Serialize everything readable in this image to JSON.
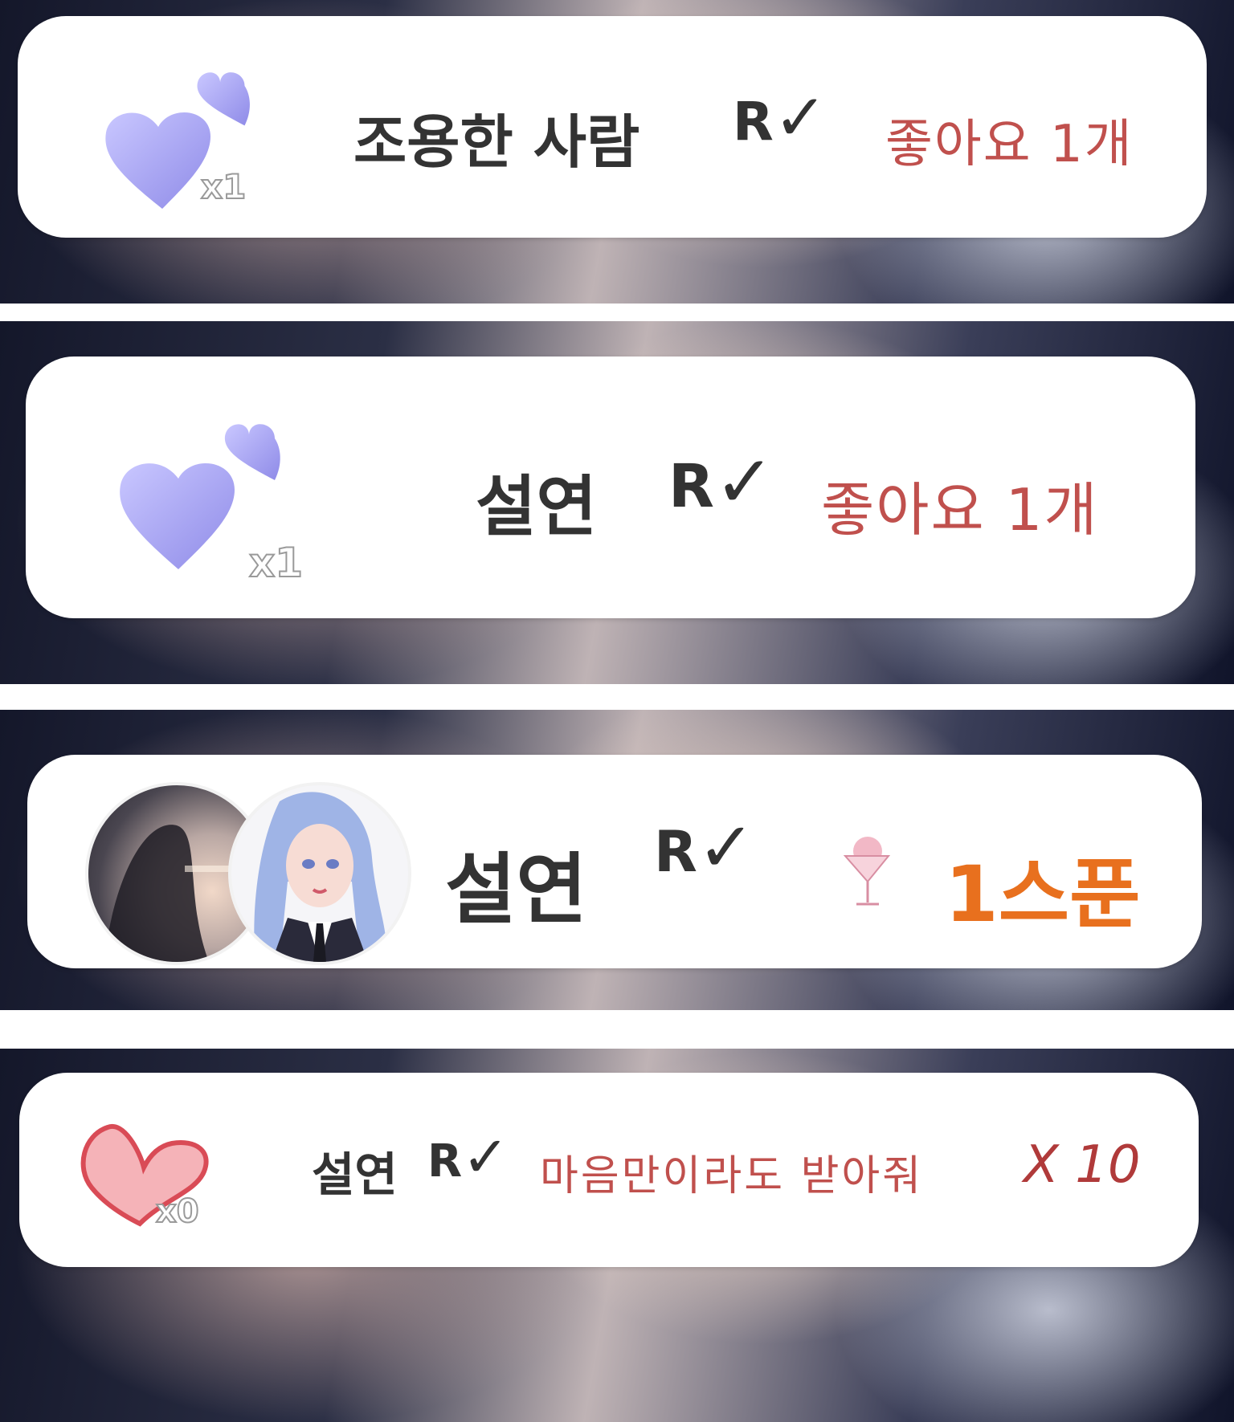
{
  "notifications": [
    {
      "icon": "purple-hearts-icon",
      "count_label": "x1",
      "user": "조용한 사람",
      "rv_mark": "R",
      "rv_check": "✓",
      "action": "좋아요 1개"
    },
    {
      "icon": "purple-hearts-icon",
      "count_label": "x1",
      "user": "설연",
      "rv_mark": "R",
      "rv_check": "✓",
      "action": "좋아요 1개"
    },
    {
      "icon": "avatars-pair",
      "user": "설연",
      "rv_mark": "R",
      "rv_check": "✓",
      "gift_icon": "cocktail-glass-icon",
      "gift_amount": "1스푼"
    },
    {
      "icon": "pink-heart-icon",
      "count_label": "x0",
      "user": "설연",
      "rv_mark": "R",
      "rv_check": "✓",
      "message": "마음만이라도 받아줘",
      "multiplier": "X 10"
    }
  ],
  "colors": {
    "card_bg": "#ffffff",
    "like_text": "#c0504d",
    "spoon_text": "#e8701e",
    "heart_purple": "#a8a6f2",
    "heart_pink": "#f4a9ab"
  }
}
